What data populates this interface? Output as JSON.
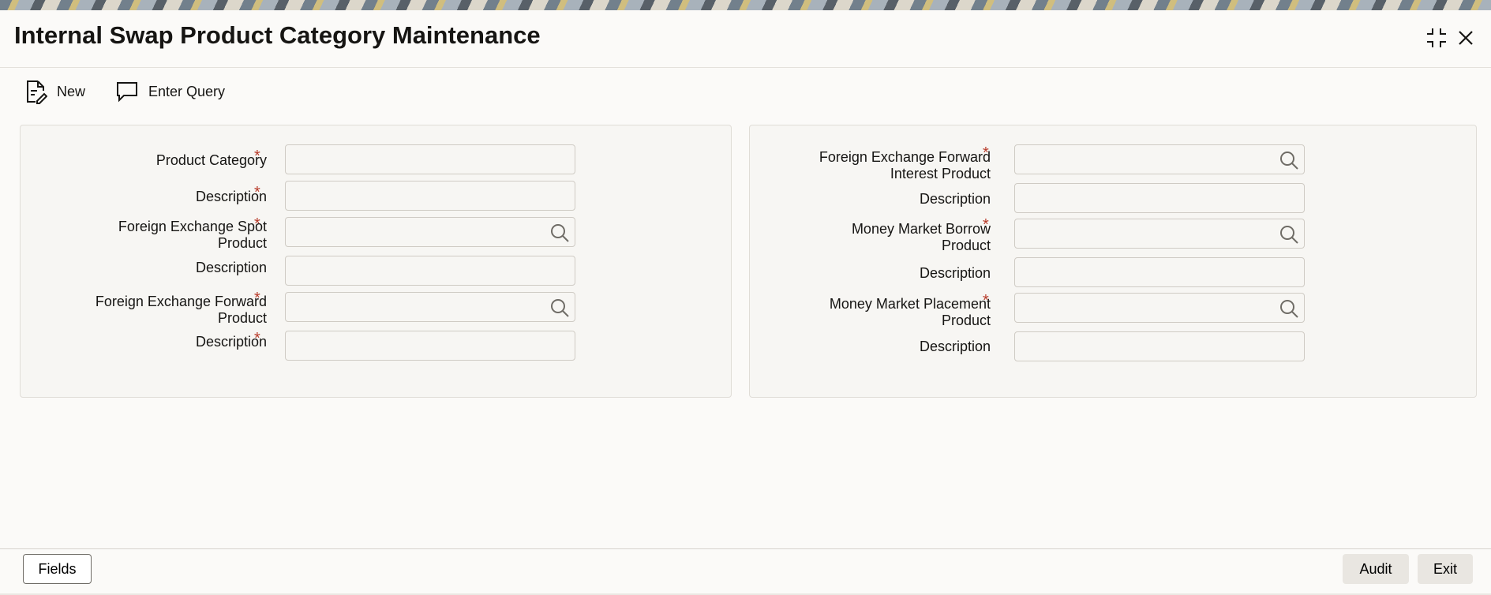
{
  "window": {
    "title": "Internal Swap Product Category Maintenance"
  },
  "toolbar": {
    "new_label": "New",
    "enter_query_label": "Enter Query"
  },
  "left_panel": {
    "product_category_label": "Product Category",
    "description1_label": "Description",
    "fx_spot_label_line1": "Foreign Exchange Spot",
    "fx_spot_label_line2": "Product",
    "description2_label": "Description",
    "fx_forward_label_line1": "Foreign Exchange Forward",
    "fx_forward_label_line2": "Product",
    "description3_label": "Description",
    "required_mark": "*"
  },
  "right_panel": {
    "fx_fwd_interest_label_line1": "Foreign Exchange Forward",
    "fx_fwd_interest_label_line2": "Interest Product",
    "description1_label": "Description",
    "mm_borrow_label_line1": "Money Market Borrow",
    "mm_borrow_label_line2": "Product",
    "description2_label": "Description",
    "mm_placement_label_line1": "Money Market Placement",
    "mm_placement_label_line2": "Product",
    "description3_label": "Description",
    "required_mark": "*"
  },
  "footer": {
    "fields_label": "Fields",
    "audit_label": "Audit",
    "exit_label": "Exit"
  },
  "colors": {
    "required": "#b83b2a",
    "panel_bg": "#f7f6f3",
    "border": "#cfcbc4"
  }
}
